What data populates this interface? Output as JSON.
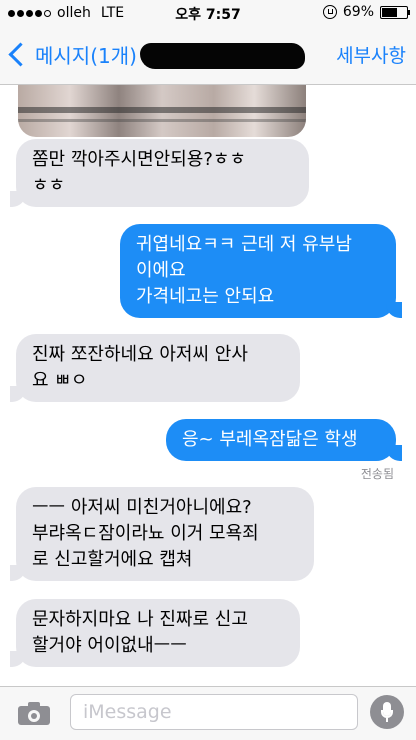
{
  "status_bar": {
    "carrier": "olleh",
    "network": "LTE",
    "time": "오후 7:57",
    "battery": "69%",
    "battery_level": 0.69,
    "signal_bars_filled": 4,
    "signal_bars_total": 5
  },
  "nav": {
    "back_label": "메시지(1개)",
    "details_label": "세부사항"
  },
  "messages": [
    {
      "direction": "incoming",
      "text": "쫌만 깍아주시면안되용?ㅎㅎ\nㅎㅎ"
    },
    {
      "direction": "outgoing",
      "text": "귀엽네요ㅋㅋ 근데 저 유부남\n이에요\n가격네고는 안되요"
    },
    {
      "direction": "incoming",
      "text": "진짜 쪼잔하네요 아저씨 안사\n요 ㅃㅇ"
    },
    {
      "direction": "outgoing",
      "text": "응~ 부레옥잠닮은 학생"
    },
    {
      "direction": "incoming",
      "text": "ㅡㅡ 아저씨 미친거아니에요?\n부랴옥ㄷ잠이라뇨 이거 모욕죄\n로 신고할거에요 캡쳐"
    },
    {
      "direction": "incoming",
      "text": "문자하지마요 나 진짜로 신고\n할거야 어이없내ㅡㅡ"
    }
  ],
  "delivery_status": "전송됨",
  "composer": {
    "placeholder": "iMessage"
  },
  "colors": {
    "accent": "#1a82fb",
    "outgoing_bubble": "#1d8df6",
    "incoming_bubble": "#e5e5ea"
  },
  "icons": [
    "back-chevron-icon",
    "camera-icon",
    "microphone-icon",
    "lock-rotation-icon",
    "battery-icon"
  ]
}
